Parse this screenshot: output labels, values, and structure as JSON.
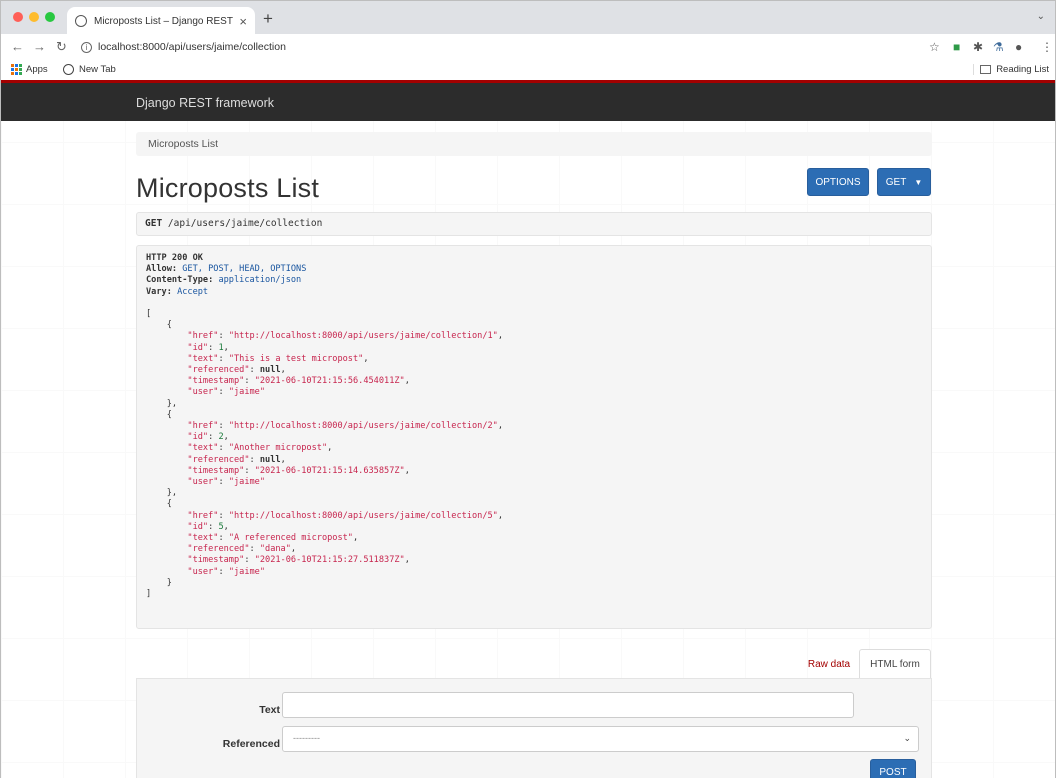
{
  "browser": {
    "tab_title": "Microposts List – Django REST",
    "url": "localhost:8000/api/users/jaime/collection",
    "bookmarks": [
      "Apps",
      "New Tab"
    ],
    "reading_list": "Reading List"
  },
  "navbar": {
    "brand": "Django REST framework"
  },
  "breadcrumb": "Microposts List",
  "page_title": "Microposts List",
  "buttons": {
    "options": "OPTIONS",
    "get": "GET",
    "post": "POST"
  },
  "request": {
    "method": "GET",
    "path": "/api/users/jaime/collection"
  },
  "response": {
    "status": "HTTP 200 OK",
    "headers": [
      {
        "name": "Allow",
        "value": "GET, POST, HEAD, OPTIONS"
      },
      {
        "name": "Content-Type",
        "value": "application/json"
      },
      {
        "name": "Vary",
        "value": "Accept"
      }
    ],
    "items": [
      {
        "href": "http://localhost:8000/api/users/jaime/collection/1",
        "id": 1,
        "text": "This is a test micropost",
        "referenced": null,
        "timestamp": "2021-06-10T21:15:56.454011Z",
        "user": "jaime"
      },
      {
        "href": "http://localhost:8000/api/users/jaime/collection/2",
        "id": 2,
        "text": "Another micropost",
        "referenced": null,
        "timestamp": "2021-06-10T21:15:14.635857Z",
        "user": "jaime"
      },
      {
        "href": "http://localhost:8000/api/users/jaime/collection/5",
        "id": 5,
        "text": "A referenced micropost",
        "referenced": "dana",
        "timestamp": "2021-06-10T21:15:27.511837Z",
        "user": "jaime"
      }
    ]
  },
  "form_tabs": {
    "raw": "Raw data",
    "html": "HTML form"
  },
  "form": {
    "text_label": "Text",
    "text_value": "",
    "referenced_label": "Referenced",
    "referenced_selected": "---------"
  }
}
